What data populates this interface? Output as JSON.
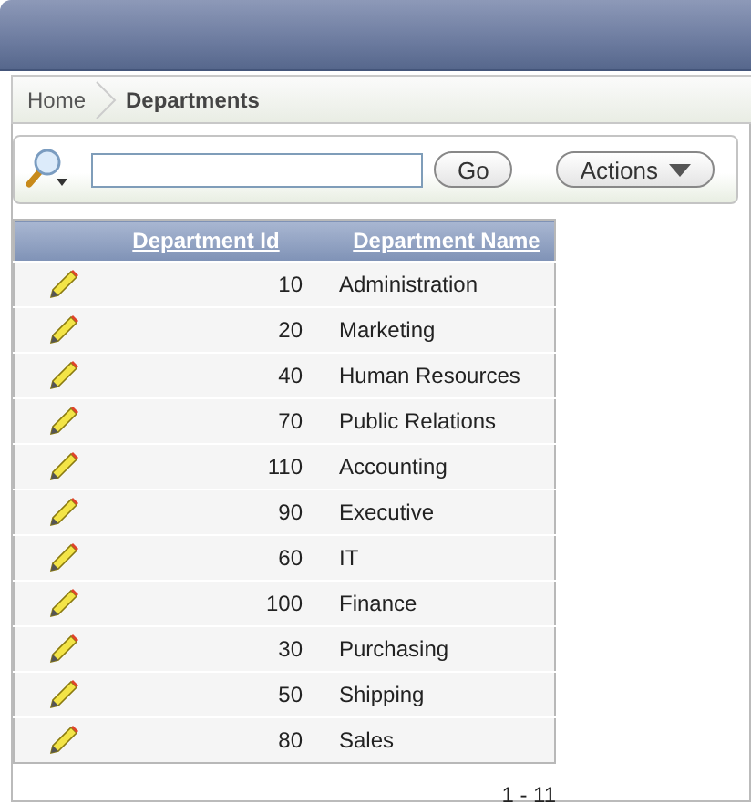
{
  "breadcrumb": [
    {
      "label": "Home",
      "selected": false
    },
    {
      "label": "Departments",
      "selected": true
    }
  ],
  "search": {
    "go": "Go",
    "actions": "Actions"
  },
  "table": {
    "columns": [
      "Department Id",
      "Department Name"
    ],
    "rows": [
      {
        "id": "10",
        "name": "Administration"
      },
      {
        "id": "20",
        "name": "Marketing"
      },
      {
        "id": "40",
        "name": "Human Resources"
      },
      {
        "id": "70",
        "name": "Public Relations"
      },
      {
        "id": "110",
        "name": "Accounting"
      },
      {
        "id": "90",
        "name": "Executive"
      },
      {
        "id": "60",
        "name": "IT"
      },
      {
        "id": "100",
        "name": "Finance"
      },
      {
        "id": "30",
        "name": "Purchasing"
      },
      {
        "id": "50",
        "name": "Shipping"
      },
      {
        "id": "80",
        "name": "Sales"
      }
    ]
  },
  "pagination": "1 - 11"
}
